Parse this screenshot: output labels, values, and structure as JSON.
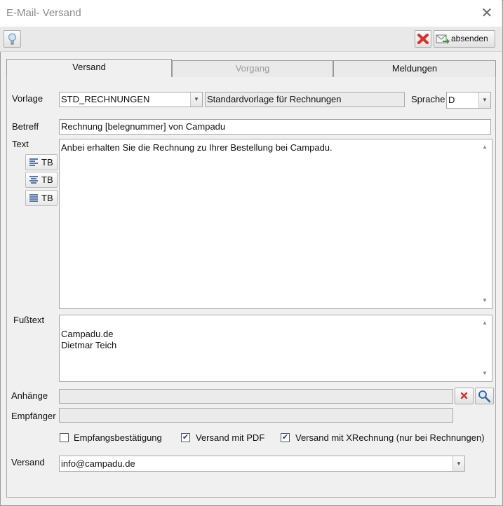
{
  "window": {
    "title": "E-Mail- Versand",
    "close_icon": "close-icon"
  },
  "toolbar": {
    "help_icon": "lightbulb-icon",
    "cancel_icon": "red-x-icon",
    "send_label": "absenden"
  },
  "tabs": [
    {
      "label": "Versand",
      "state": "active"
    },
    {
      "label": "Vorgang",
      "state": "disabled"
    },
    {
      "label": "Meldungen",
      "state": "normal"
    }
  ],
  "form": {
    "vorlage_label": "Vorlage",
    "vorlage_value": "STD_RECHNUNGEN",
    "vorlage_desc": "Standardvorlage für Rechnungen",
    "sprache_label": "Sprache",
    "sprache_value": "D",
    "betreff_label": "Betreff",
    "betreff_value": "Rechnung [belegnummer] von Campadu",
    "text_label": "Text",
    "text_value": "Anbei erhalten Sie die Rechnung zu Ihrer Bestellung bei Campadu.",
    "tb_buttons": [
      "TB",
      "TB",
      "TB"
    ],
    "fusstext_label": "Fußtext",
    "fusstext_lines": [
      "",
      "Campadu.de",
      "Dietmar Teich"
    ],
    "anhaenge_label": "Anhänge",
    "anhaenge_value": "",
    "empfaenger_label": "Empfänger",
    "empfaenger_value": "",
    "checkboxes": [
      {
        "label": "Empfangsbestätigung",
        "checked": false
      },
      {
        "label": "Versand mit PDF",
        "checked": true
      },
      {
        "label": "Versand mit XRechnung (nur bei Rechnungen)",
        "checked": true
      }
    ],
    "versand_label": "Versand",
    "versand_value": "info@campadu.de"
  },
  "colors": {
    "accent_red": "#d9302c",
    "check_blue": "#1e3a8a",
    "window_bg": "#f0f0f0"
  }
}
